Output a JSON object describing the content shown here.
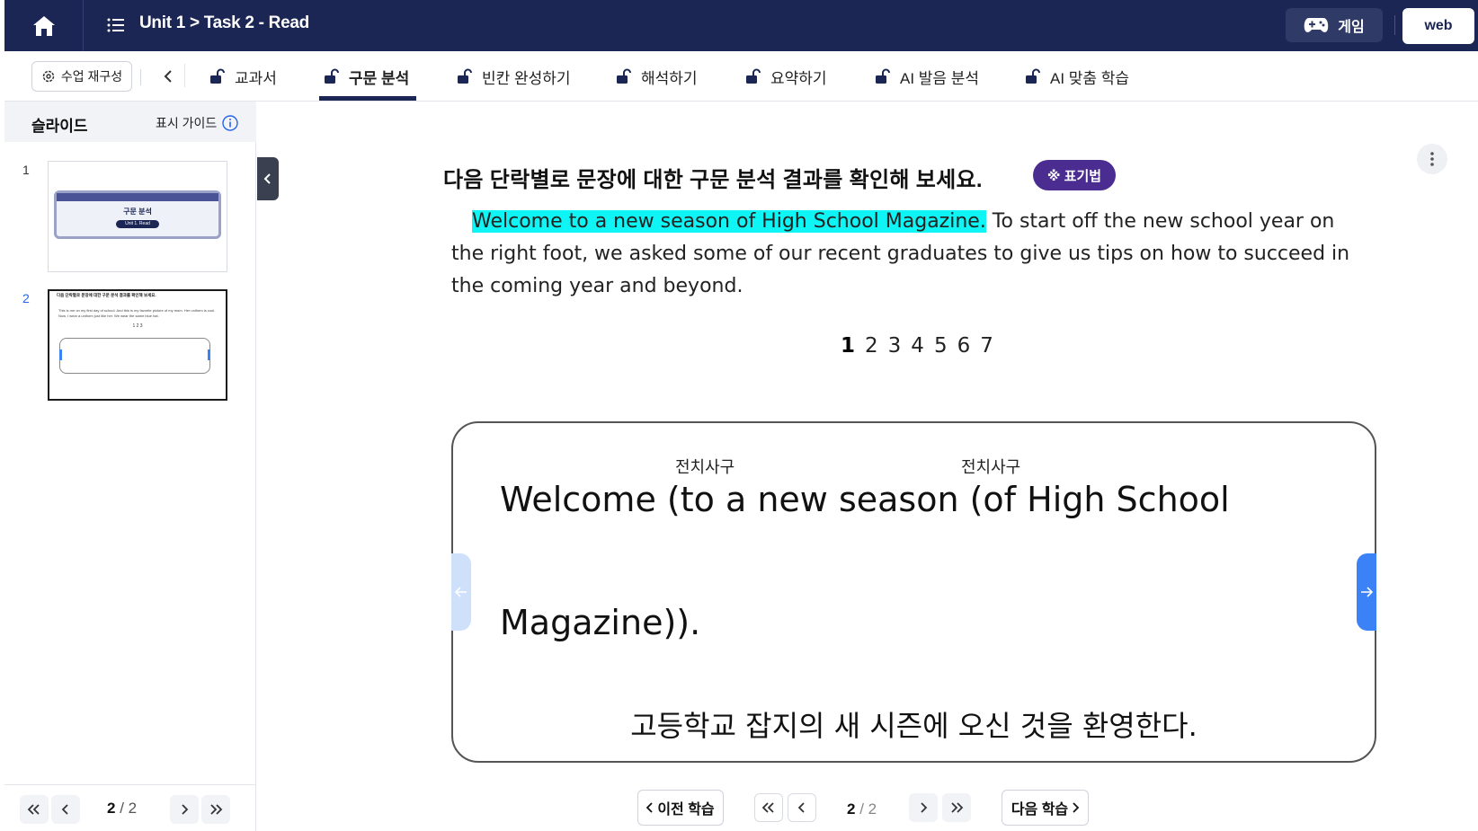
{
  "header": {
    "breadcrumb": "Unit 1 > Task 2 - Read",
    "game_label": "게임",
    "web_label": "web"
  },
  "toolbar": {
    "reconfigure_label": "수업 재구성"
  },
  "tabs": [
    {
      "label": "교과서",
      "active": false
    },
    {
      "label": "구문 분석",
      "active": true
    },
    {
      "label": "빈칸 완성하기",
      "active": false
    },
    {
      "label": "해석하기",
      "active": false
    },
    {
      "label": "요약하기",
      "active": false
    },
    {
      "label": "AI 발음 분석",
      "active": false
    },
    {
      "label": "AI 맞춤 학습",
      "active": false
    }
  ],
  "sidebar": {
    "title": "슬라이드",
    "guide_label": "표시 가이드",
    "slides": [
      {
        "number": "1",
        "thumb_title": "구문 분석",
        "thumb_sub": "Unit 1. Read"
      },
      {
        "number": "2",
        "thumb_title": "다음 단락별로 문장에 대한 구문 분석 결과를 확인해 보세요.",
        "thumb_text": "This is me on my first day of school. And this is my favorite picture of my mom. Her uniform is cool. Now, I wear a uniform just like her. We wear the same blue hat.",
        "thumb_nums": "1 2 3"
      }
    ],
    "pager": {
      "current": "2",
      "total": "/ 2"
    }
  },
  "main": {
    "instruction": "다음 단락별로 문장에 대한 구문 분석 결과를 확인해 보세요.",
    "legend_chip": "※ 표기법",
    "passage_highlight": "Welcome to a new season of High School Magazine.",
    "passage_rest": " To start off the new school year on the right foot, we asked some of our recent graduates to give us tips on how to succeed in the coming year and beyond.",
    "sentence_numbers": [
      "1",
      "2",
      "3",
      "4",
      "5",
      "6",
      "7"
    ],
    "current_sentence": "1",
    "analysis": {
      "tag1": "전치사구",
      "tag2": "전치사구",
      "line1_part1": "Welcome (to a new season (of High School",
      "line2": "Magazine)).",
      "translation": "고등학교 잡지의 새 시즌에 오신 것을 환영한다."
    }
  },
  "bottom_pager": {
    "prev_label": "이전 학습",
    "next_label": "다음 학습",
    "current": "2",
    "total": "/ 2"
  },
  "colors": {
    "topbar": "#1b2655",
    "highlight": "#0ff4f4",
    "legend_chip": "#4b2d92",
    "arrow_active": "#3b82f6"
  }
}
